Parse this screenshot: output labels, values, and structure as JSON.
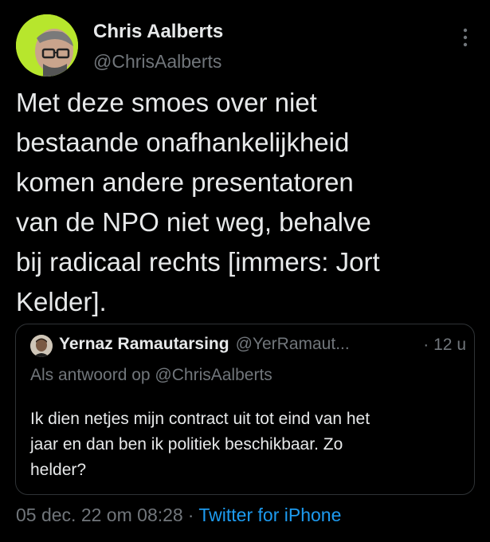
{
  "tweet": {
    "author": {
      "name": "Chris Aalberts",
      "handle": "@ChrisAalberts"
    },
    "text_lines": [
      "Met deze smoes over niet",
      "bestaande onafhankelijkheid",
      "komen andere presentatoren",
      "van de NPO niet weg, behalve",
      "bij radicaal rechts [immers: Jort",
      "Kelder]."
    ],
    "quoted": {
      "author_name": "Yernaz Ramautarsing",
      "author_handle": "@YerRamaut...",
      "time_ago": "· 12 u",
      "reply_to": "Als antwoord op @ChrisAalberts",
      "text_lines": [
        "Ik dien netjes mijn contract uit tot eind van het",
        "jaar en dan ben ik politiek beschikbaar. Zo",
        "helder?"
      ]
    },
    "meta": {
      "timestamp": "05 dec. 22 om 08:28",
      "separator": "·",
      "source": "Twitter for iPhone"
    }
  },
  "icons": {
    "more": "more-vertical-icon"
  },
  "colors": {
    "background": "#000000",
    "text_primary": "#e7e9ea",
    "text_secondary": "#71767b",
    "link": "#1d9bf0",
    "border": "#2f3336",
    "avatar_bg": "#b7e62d"
  }
}
